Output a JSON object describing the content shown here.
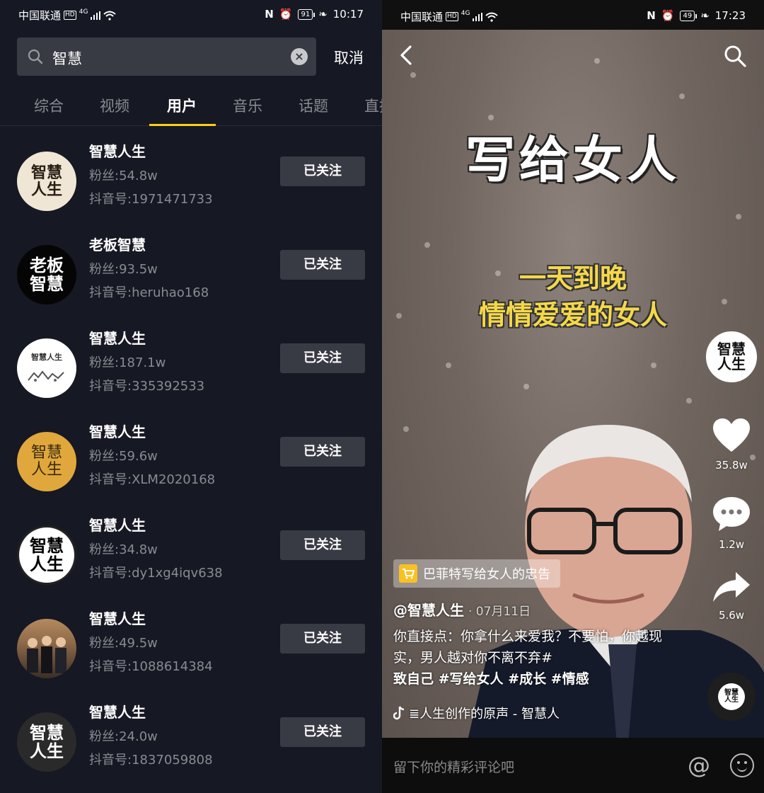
{
  "left": {
    "status": {
      "carrier": "中国联通",
      "hd": "HD",
      "net": "4G",
      "battery": "91",
      "time": "10:17"
    },
    "search": {
      "query": "智慧",
      "cancel": "取消"
    },
    "tabs": [
      "综合",
      "视频",
      "用户",
      "音乐",
      "话题",
      "直播"
    ],
    "active_tab": "用户",
    "users": [
      {
        "name": "智慧人生",
        "fans": "粉丝:54.8w",
        "id": "抖音号:1971471733",
        "avatar_text": "智慧人生",
        "button": "已关注"
      },
      {
        "name": "老板智慧",
        "fans": "粉丝:93.5w",
        "id": "抖音号:heruhao168",
        "avatar_text": "老板智慧",
        "button": "已关注"
      },
      {
        "name": "智慧人生",
        "fans": "粉丝:187.1w",
        "id": "抖音号:335392533",
        "avatar_text": "智慧人生",
        "button": "已关注"
      },
      {
        "name": "智慧人生",
        "fans": "粉丝:59.6w",
        "id": "抖音号:XLM2020168",
        "avatar_text": "智慧人生",
        "button": "已关注"
      },
      {
        "name": "智慧人生",
        "fans": "粉丝:34.8w",
        "id": "抖音号:dy1xg4iqv638",
        "avatar_text": "智慧人生",
        "button": "已关注"
      },
      {
        "name": "智慧人生",
        "fans": "粉丝:49.5w",
        "id": "抖音号:1088614384",
        "avatar_text": "",
        "button": "已关注"
      },
      {
        "name": "智慧人生",
        "fans": "粉丝:24.0w",
        "id": "抖音号:1837059808",
        "avatar_text": "智慧人生",
        "button": "已关注"
      }
    ]
  },
  "right": {
    "status": {
      "carrier": "中国联通",
      "hd": "HD",
      "net": "4G",
      "battery": "49",
      "time": "17:23"
    },
    "video_title": "写给女人",
    "video_subtitle_1": "一天到晚",
    "video_subtitle_2": "情情爱爱的女人",
    "side_avatar_text": "智慧人生",
    "likes": "35.8w",
    "comments": "1.2w",
    "shares": "5.6w",
    "product": "巴菲特写给女人的忠告",
    "author": "@智慧人生",
    "date": "· 07月11日",
    "desc_1": "你直接点：你拿什么来爱我？不要怕，你越现实，男人越对你不离不弃#",
    "desc_2": "致自己 #写给女人 #成长 #情感",
    "music": "≣人生创作的原声 - 智慧人",
    "comment_placeholder": "留下你的精彩评论吧",
    "at": "@"
  },
  "colors": {
    "accent": "#face15",
    "bg_dark": "#161823",
    "button_bg": "#393b44"
  }
}
